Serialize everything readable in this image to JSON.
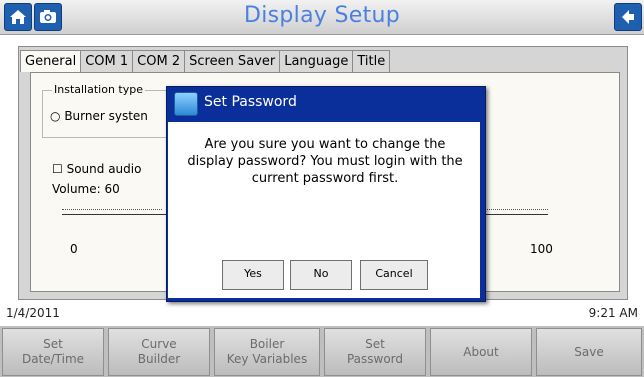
{
  "header": {
    "title": "Display Setup",
    "home_icon": "home-icon",
    "camera_icon": "camera-icon",
    "back_icon": "back-arrow-icon",
    "accent_color": "#4b7fe0"
  },
  "tabs": [
    {
      "label": "General",
      "active": true
    },
    {
      "label": "COM 1",
      "active": false
    },
    {
      "label": "COM 2",
      "active": false
    },
    {
      "label": "Screen Saver",
      "active": false
    },
    {
      "label": "Language",
      "active": false
    },
    {
      "label": "Title",
      "active": false
    }
  ],
  "general": {
    "installation_type_label": "Installation type",
    "burner_option": "Burner systen",
    "sound_label": "Sound audio",
    "volume_label": "Volume: 60",
    "volume_value": 60,
    "slider_min": "0",
    "slider_max": "100"
  },
  "dialog": {
    "title": "Set Password",
    "message": "Are you sure you want to change the display password? You must login with the current password first.",
    "buttons": [
      "Yes",
      "No",
      "Cancel"
    ]
  },
  "status": {
    "date": "1/4/2011",
    "time": "9:21 AM"
  },
  "bottom_buttons": [
    "Set\nDate/Time",
    "Curve\nBuilder",
    "Boiler\nKey Variables",
    "Set\nPassword",
    "About",
    "Save"
  ]
}
